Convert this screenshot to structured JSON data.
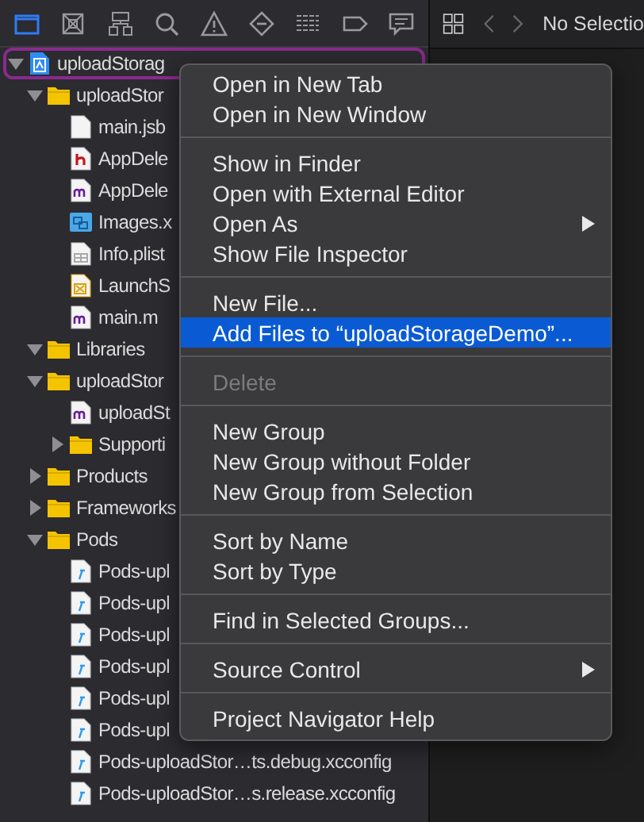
{
  "navigator_tabs": [
    {
      "selected": true
    },
    {
      "selected": false
    },
    {
      "selected": false
    },
    {
      "selected": false
    },
    {
      "selected": false
    },
    {
      "selected": false
    },
    {
      "selected": false
    },
    {
      "selected": false
    },
    {
      "selected": false
    }
  ],
  "editor_bar": {
    "title": "No Selectio"
  },
  "tree": [
    {
      "label": "uploadStorag",
      "kind": "project",
      "expanded": true,
      "selected": true,
      "children": [
        {
          "label": "uploadStor",
          "kind": "folder",
          "expanded": true,
          "children": [
            {
              "label": "main.jsb",
              "kind": "file"
            },
            {
              "label": "AppDele",
              "kind": "header"
            },
            {
              "label": "AppDele",
              "kind": "source"
            },
            {
              "label": "Images.x",
              "kind": "assets"
            },
            {
              "label": "Info.plist",
              "kind": "plist"
            },
            {
              "label": "LaunchS",
              "kind": "storyboard"
            },
            {
              "label": "main.m",
              "kind": "source"
            }
          ]
        },
        {
          "label": "Libraries",
          "kind": "folder",
          "expanded": true
        },
        {
          "label": "uploadStor",
          "kind": "folder",
          "expanded": true,
          "children": [
            {
              "label": "uploadSt",
              "kind": "source"
            },
            {
              "label": "Supporti",
              "kind": "folder",
              "expanded": false
            }
          ]
        },
        {
          "label": "Products",
          "kind": "folder",
          "expanded": false
        },
        {
          "label": "Frameworks",
          "kind": "folder",
          "expanded": false
        },
        {
          "label": "Pods",
          "kind": "folder",
          "expanded": true,
          "children": [
            {
              "label": "Pods-upl",
              "kind": "config"
            },
            {
              "label": "Pods-upl",
              "kind": "config"
            },
            {
              "label": "Pods-upl",
              "kind": "config"
            },
            {
              "label": "Pods-upl",
              "kind": "config"
            },
            {
              "label": "Pods-upl",
              "kind": "config"
            },
            {
              "label": "Pods-upl",
              "kind": "config"
            },
            {
              "label": "Pods-uploadStor…ts.debug.xcconfig",
              "kind": "config"
            },
            {
              "label": "Pods-uploadStor…s.release.xcconfig",
              "kind": "config"
            }
          ]
        }
      ]
    }
  ],
  "context_menu": {
    "groups": [
      [
        {
          "label": "Open in New Tab",
          "selected": false,
          "disabled": false
        },
        {
          "label": "Open in New Window",
          "selected": false,
          "disabled": false
        }
      ],
      [
        {
          "label": "Show in Finder",
          "selected": false,
          "disabled": false
        },
        {
          "label": "Open with External Editor",
          "selected": false,
          "disabled": false
        },
        {
          "label": "Open As",
          "selected": false,
          "disabled": false,
          "submenu": true
        },
        {
          "label": "Show File Inspector",
          "selected": false,
          "disabled": false
        }
      ],
      [
        {
          "label": "New File...",
          "selected": false,
          "disabled": false
        },
        {
          "label": "Add Files to “uploadStorageDemo”...",
          "selected": true,
          "disabled": false
        }
      ],
      [
        {
          "label": "Delete",
          "selected": false,
          "disabled": true
        }
      ],
      [
        {
          "label": "New Group",
          "selected": false,
          "disabled": false
        },
        {
          "label": "New Group without Folder",
          "selected": false,
          "disabled": false
        },
        {
          "label": "New Group from Selection",
          "selected": false,
          "disabled": false
        }
      ],
      [
        {
          "label": "Sort by Name",
          "selected": false,
          "disabled": false
        },
        {
          "label": "Sort by Type",
          "selected": false,
          "disabled": false
        }
      ],
      [
        {
          "label": "Find in Selected Groups...",
          "selected": false,
          "disabled": false
        }
      ],
      [
        {
          "label": "Source Control",
          "selected": false,
          "disabled": false,
          "submenu": true
        }
      ],
      [
        {
          "label": "Project Navigator Help",
          "selected": false,
          "disabled": false
        }
      ]
    ]
  }
}
